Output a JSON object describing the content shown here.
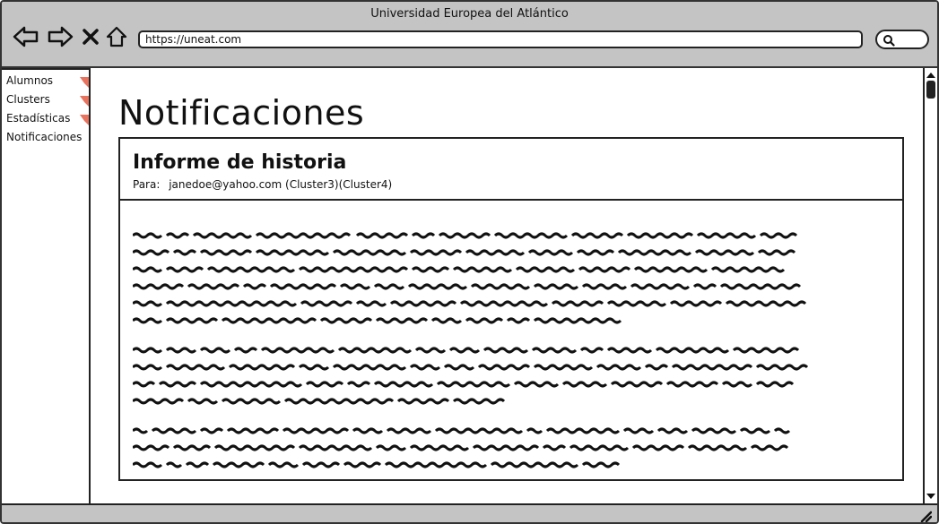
{
  "window": {
    "title": "Universidad Europea del Atlántico"
  },
  "toolbar": {
    "back_icon": "arrow-left-icon",
    "forward_icon": "arrow-right-icon",
    "stop_icon": "close-icon",
    "home_icon": "home-icon",
    "url": "https://uneat.com",
    "search_icon": "search-icon"
  },
  "sidebar": {
    "items": [
      {
        "label": "Alumnos",
        "flag": true
      },
      {
        "label": "Clusters",
        "flag": true
      },
      {
        "label": "Estadísticas",
        "flag": true
      },
      {
        "label": "Notificaciones",
        "flag": false
      }
    ],
    "flag_color": "#e8735e"
  },
  "main": {
    "title": "Notificaciones",
    "notification": {
      "title": "Informe de historia",
      "to_label": "Para:",
      "recipient": "janedoe@yahoo.com (Cluster3)(Cluster4)"
    }
  },
  "colors": {
    "chrome": "#c4c4c4",
    "border": "#222222"
  }
}
